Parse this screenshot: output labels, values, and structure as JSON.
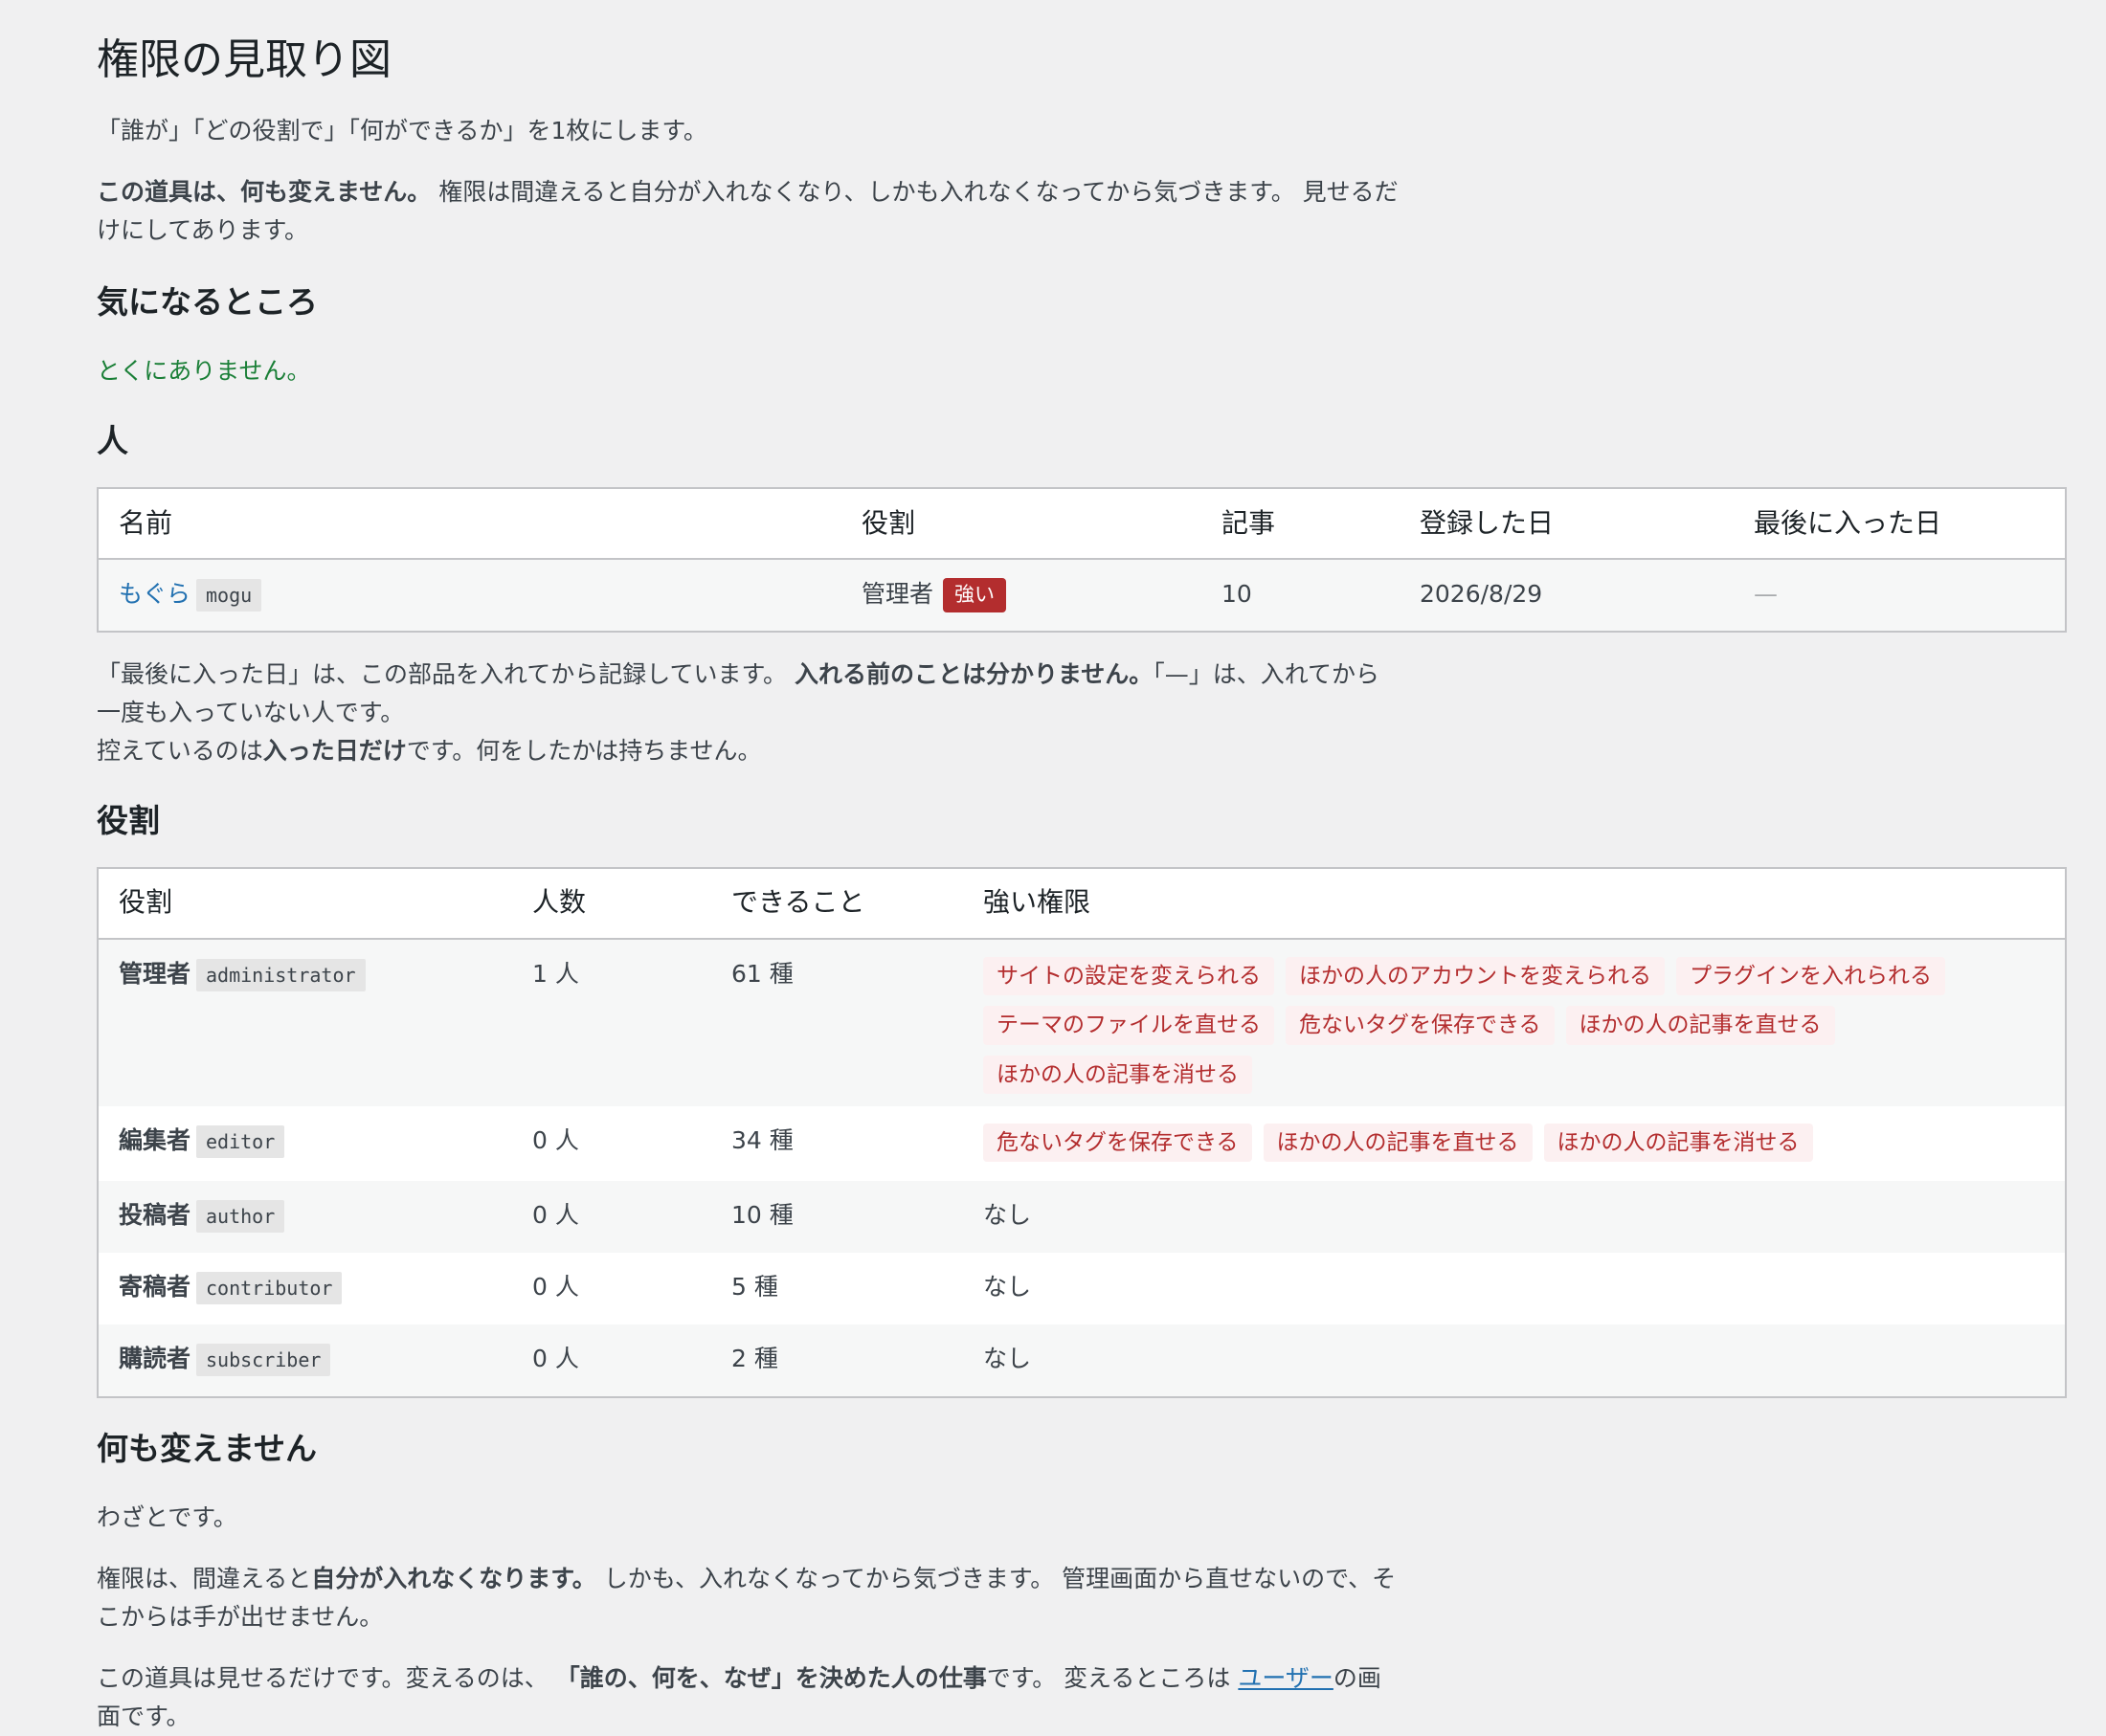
{
  "page": {
    "title": "権限の見取り図",
    "subtitle": "「誰が」「どの役割で」「何ができるか」を1枚にします。",
    "notice_bold": "この道具は、何も変えません。",
    "notice_rest": " 権限は間違えると自分が入れなくなり、しかも入れなくなってから気づきます。 見せるだけにしてあります。"
  },
  "concerns": {
    "heading": "気になるところ",
    "message": "とくにありません。"
  },
  "people": {
    "heading": "人",
    "columns": [
      "名前",
      "役割",
      "記事",
      "登録した日",
      "最後に入った日"
    ],
    "rows": [
      {
        "display_name": "もぐら",
        "login": "mogu",
        "role": "管理者",
        "role_badge": "強い",
        "posts": "10",
        "registered": "2026/8/29",
        "last_login": "—"
      }
    ],
    "note_part1": "「最後に入った日」は、この部品を入れてから記録しています。 ",
    "note_bold1": "入れる前のことは分かりません。",
    "note_part2": "「—」は、入れてから一度も入っていない人です。",
    "note2_part1": "控えているのは",
    "note2_bold": "入った日だけ",
    "note2_part2": "です。何をしたかは持ちません。"
  },
  "roles": {
    "heading": "役割",
    "columns": [
      "役割",
      "人数",
      "できること",
      "強い権限"
    ],
    "rows": [
      {
        "name": "管理者",
        "slug": "administrator",
        "count": "1 人",
        "caps": "61 種",
        "strong": [
          "サイトの設定を変えられる",
          "ほかの人のアカウントを変えられる",
          "プラグインを入れられる",
          "テーマのファイルを直せる",
          "危ないタグを保存できる",
          "ほかの人の記事を直せる",
          "ほかの人の記事を消せる"
        ]
      },
      {
        "name": "編集者",
        "slug": "editor",
        "count": "0 人",
        "caps": "34 種",
        "strong": [
          "危ないタグを保存できる",
          "ほかの人の記事を直せる",
          "ほかの人の記事を消せる"
        ]
      },
      {
        "name": "投稿者",
        "slug": "author",
        "count": "0 人",
        "caps": "10 種",
        "strong": [],
        "none_label": "なし"
      },
      {
        "name": "寄稿者",
        "slug": "contributor",
        "count": "0 人",
        "caps": "5 種",
        "strong": [],
        "none_label": "なし"
      },
      {
        "name": "購読者",
        "slug": "subscriber",
        "count": "0 人",
        "caps": "2 種",
        "strong": [],
        "none_label": "なし"
      }
    ]
  },
  "readonly": {
    "heading": "何も変えません",
    "p1": "わざとです。",
    "p2_part1": "権限は、間違えると",
    "p2_bold": "自分が入れなくなります。",
    "p2_part2": " しかも、入れなくなってから気づきます。 管理画面から直せないので、そこからは手が出せません。",
    "p3_part1": "この道具は見せるだけです。変えるのは、 ",
    "p3_bold": "「誰の、何を、なぜ」を決めた人の仕事",
    "p3_part2": "です。 変えるところは ",
    "p3_link": "ユーザー",
    "p3_part3": "の画面です。"
  }
}
